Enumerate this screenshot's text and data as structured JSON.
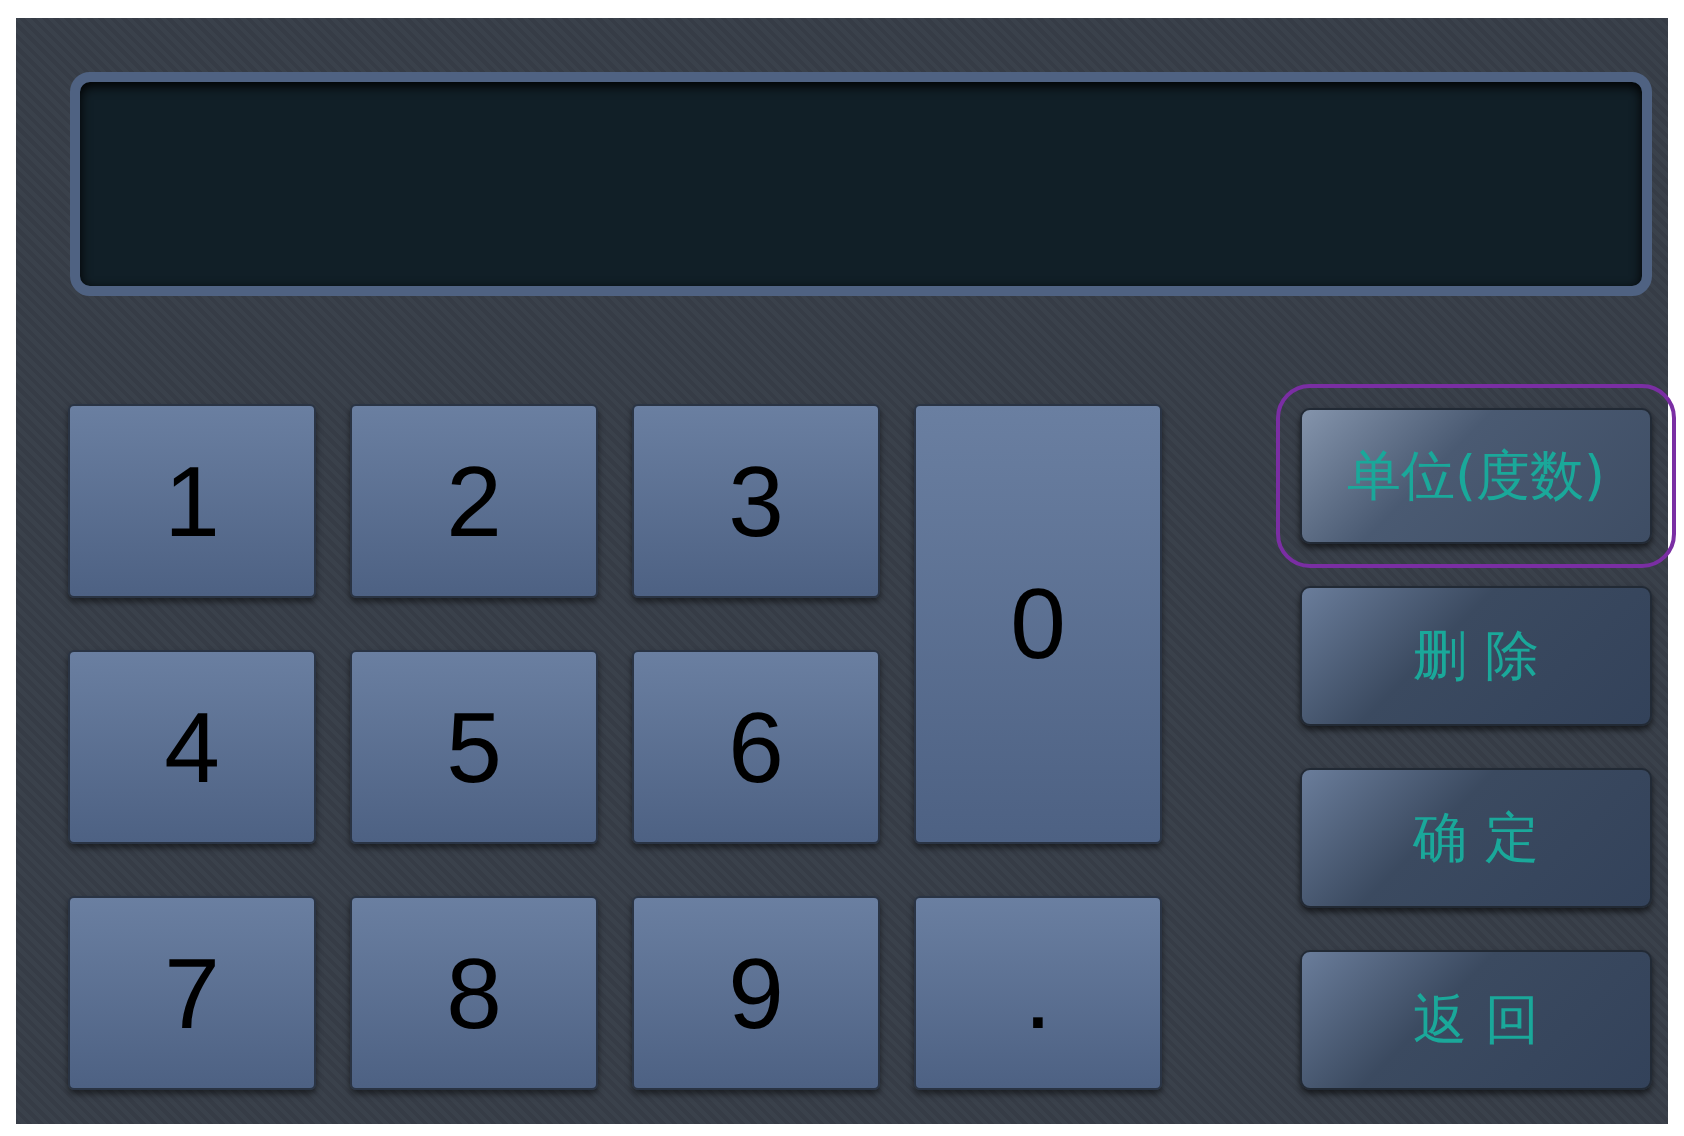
{
  "keys": [
    {
      "label": "1",
      "kind": "normal"
    },
    {
      "label": "2",
      "kind": "normal"
    },
    {
      "label": "3",
      "kind": "normal"
    },
    {
      "label": "0",
      "kind": "tall"
    },
    {
      "label": "4",
      "kind": "normal"
    },
    {
      "label": "5",
      "kind": "normal"
    },
    {
      "label": "6",
      "kind": "normal"
    },
    {
      "label": "7",
      "kind": "normal"
    },
    {
      "label": "8",
      "kind": "normal"
    },
    {
      "label": "9",
      "kind": "normal"
    },
    {
      "label": ".",
      "kind": "normal"
    }
  ],
  "side_buttons": [
    {
      "label": "单位(度数)",
      "selected": true
    },
    {
      "label": "删 除",
      "selected": false
    },
    {
      "label": "确 定",
      "selected": false
    },
    {
      "label": "返 回",
      "selected": false
    }
  ]
}
